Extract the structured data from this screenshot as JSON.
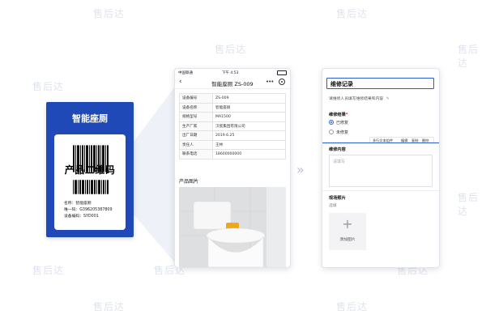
{
  "watermark": "售后达",
  "qr_card": {
    "title": "智能座厕",
    "big_text": "产品二维码",
    "info": [
      "名称：智能座厕",
      "唯一码：G396205387809",
      "设备编码：SYD001"
    ]
  },
  "phone": {
    "status": {
      "carrier": "中国联通",
      "time": "下午 4:53"
    },
    "title": "智能座厕 ZS-009",
    "back_icon": "chevron-left-icon",
    "rows": [
      {
        "key": "设备编号",
        "value": "ZS-009"
      },
      {
        "key": "设备名称",
        "value": "智能座厕"
      },
      {
        "key": "规格型号",
        "value": "MA1500"
      },
      {
        "key": "生产厂家",
        "value": "汉宸集团有限公司"
      },
      {
        "key": "出厂日期",
        "value": "2019.6.25"
      },
      {
        "key": "责任人",
        "value": "王林"
      },
      {
        "key": "联系电话",
        "value": "18600000000"
      }
    ],
    "photo_label": "产品图片"
  },
  "form": {
    "title": "维修记录",
    "description": "请维修人员填写维修结果和内容",
    "result_label": "维修结果",
    "options": [
      {
        "label": "已修复",
        "selected": true
      },
      {
        "label": "未修复",
        "selected": false
      }
    ],
    "toolbar": {
      "type": "多行文本组件",
      "edit": "编辑",
      "copy": "复制",
      "delete": "删除"
    },
    "content_label": "维修内容",
    "content_placeholder": "请填写",
    "photo_label": "现场照片",
    "photo_sub": "选填",
    "upload_label": "添加图片"
  },
  "colors": {
    "brand": "#1f49b6",
    "accent": "#2d5bd7",
    "required": "#e02020"
  }
}
